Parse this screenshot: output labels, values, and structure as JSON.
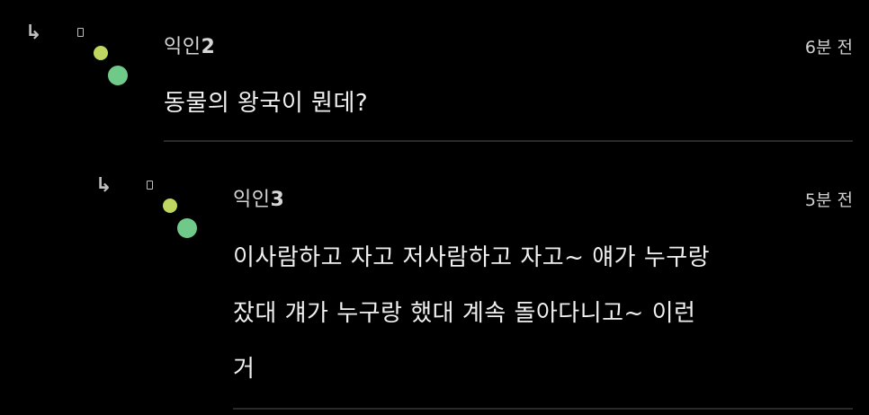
{
  "comments": [
    {
      "author_prefix": "익인",
      "author_number": "2",
      "time": "6분 전",
      "body_lines": [
        "동물의 왕국이 뭔데?"
      ],
      "reply_icon": "reply-arrow-icon",
      "badge_icon": "phone-icon",
      "dot_colors": [
        "#bfd661",
        "#6fca8a"
      ]
    },
    {
      "author_prefix": "익인",
      "author_number": "3",
      "time": "5분 전",
      "body_lines": [
        "이사람하고 자고 저사람하고 자고~ 얘가 누구랑",
        "잤대 걔가 누구랑 했대 계속 돌아다니고~ 이런",
        "거"
      ],
      "reply_icon": "reply-arrow-icon",
      "badge_icon": "phone-icon",
      "dot_colors": [
        "#bfd661",
        "#6fca8a"
      ]
    }
  ],
  "colors": {
    "background": "#000000",
    "text": "#f0f0f0",
    "divider": "#2a2a2a"
  }
}
